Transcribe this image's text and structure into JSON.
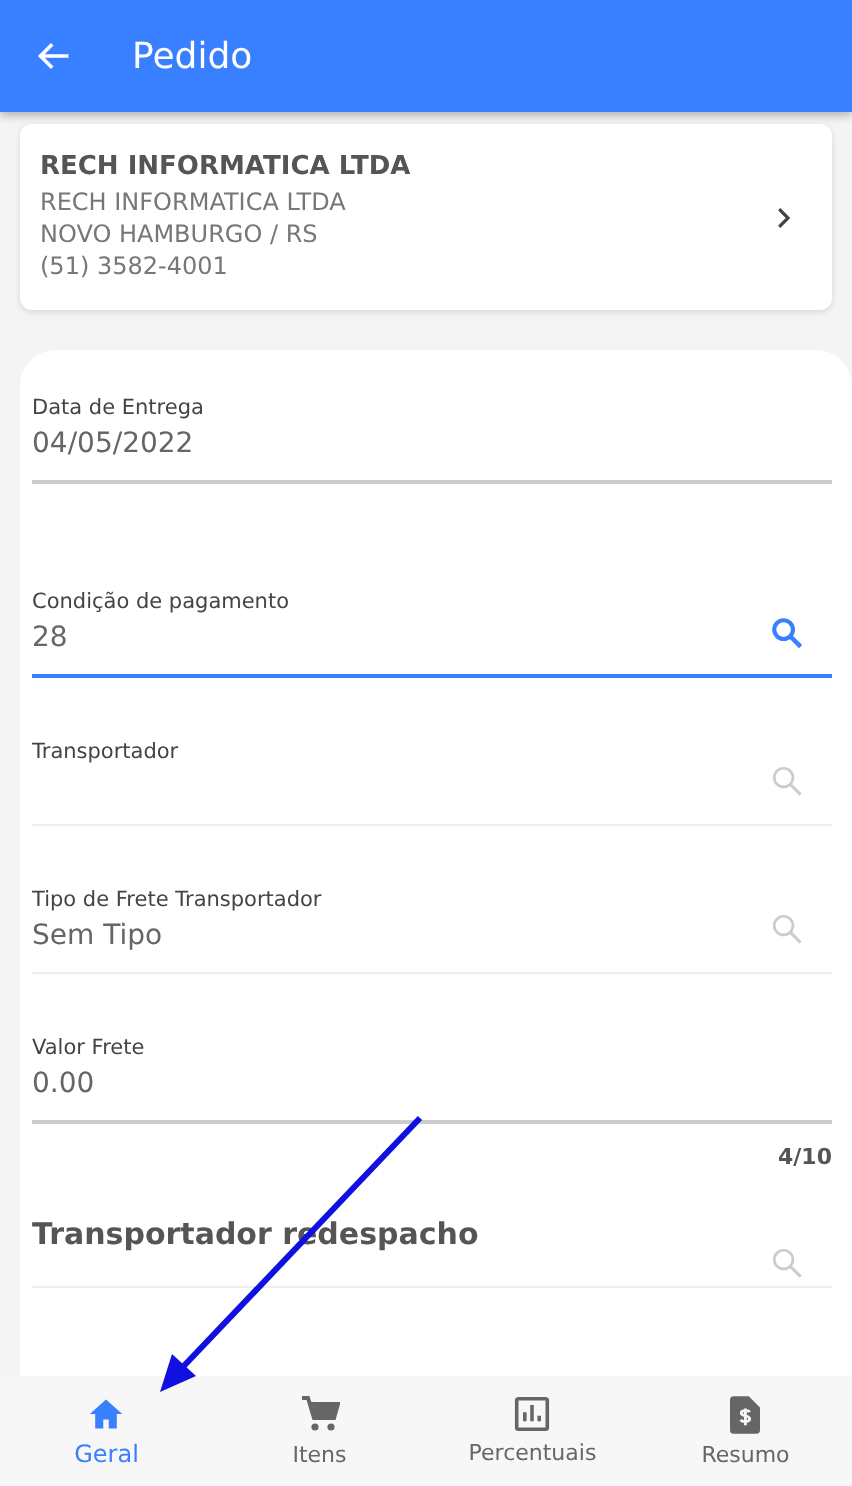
{
  "header": {
    "title": "Pedido"
  },
  "customer": {
    "name": "RECH INFORMATICA LTDA",
    "lines": [
      "RECH INFORMATICA LTDA",
      "NOVO HAMBURGO / RS",
      "(51) 3582-4001"
    ]
  },
  "fields": [
    {
      "kind": "text",
      "label": "Data de Entrega",
      "value": "04/05/2022",
      "focused": false
    },
    {
      "kind": "lookup",
      "label": "Condição de pagamento",
      "value": "28",
      "focused": true
    },
    {
      "kind": "lookup",
      "label": "Transportador",
      "focused": false
    },
    {
      "kind": "lookup",
      "label": "Tipo de Frete Transportador",
      "value": "Sem Tipo",
      "focused": false
    },
    {
      "kind": "text",
      "label": "Valor Frete",
      "value": "0.00",
      "focused": false,
      "counter": "4/10"
    },
    {
      "kind": "lookup",
      "placeholder": "Transportador redespacho",
      "focused": false
    }
  ],
  "tabs": [
    {
      "label": "Geral",
      "selected": true
    },
    {
      "label": "Itens",
      "selected": false
    },
    {
      "label": "Percentuais",
      "selected": false
    },
    {
      "label": "Resumo",
      "selected": false
    }
  ]
}
